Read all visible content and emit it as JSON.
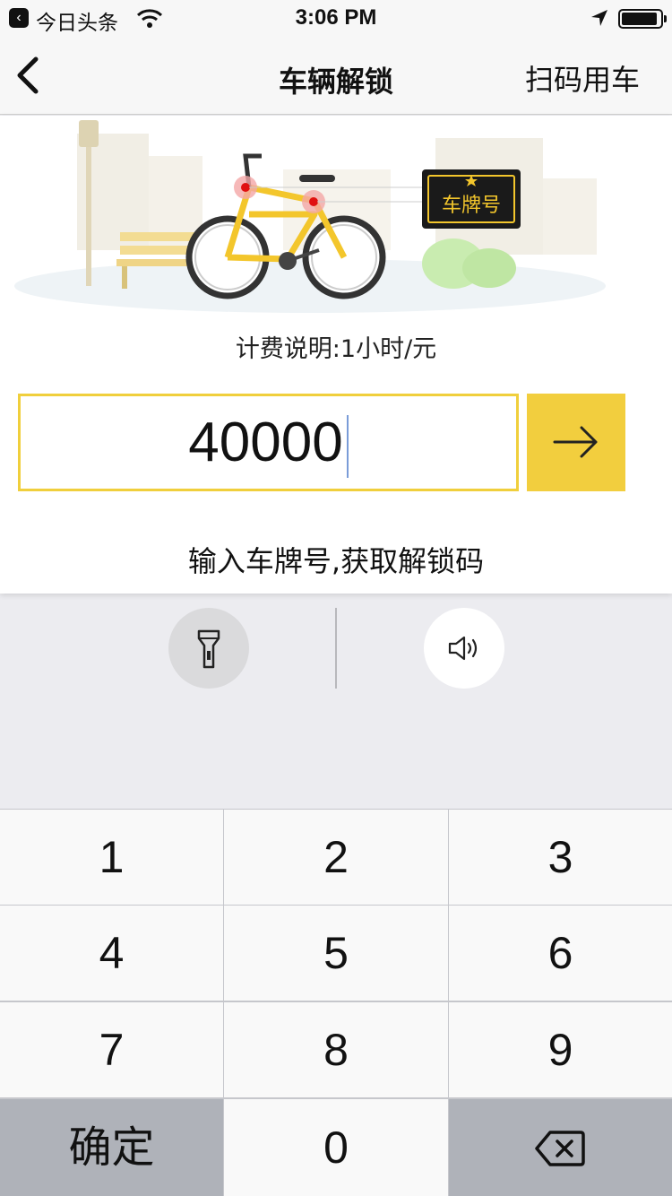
{
  "status_bar": {
    "back_app_label": "今日头条",
    "time": "3:06 PM",
    "battery_level": 0.92
  },
  "nav": {
    "title": "车辆解锁",
    "right_action": "扫码用车"
  },
  "illustration": {
    "plate_tag": "车牌号"
  },
  "fee_note": "计费说明:1小时/元",
  "plate_input": {
    "value": "40000"
  },
  "hint": "输入车牌号,获取解锁码",
  "keypad": {
    "keys": [
      "1",
      "2",
      "3",
      "4",
      "5",
      "6",
      "7",
      "8",
      "9"
    ],
    "zero": "0",
    "confirm": "确定"
  },
  "colors": {
    "accent": "#f2ce3e",
    "input_border": "#f0cf3c",
    "keypad_dark": "#afb2b9"
  }
}
